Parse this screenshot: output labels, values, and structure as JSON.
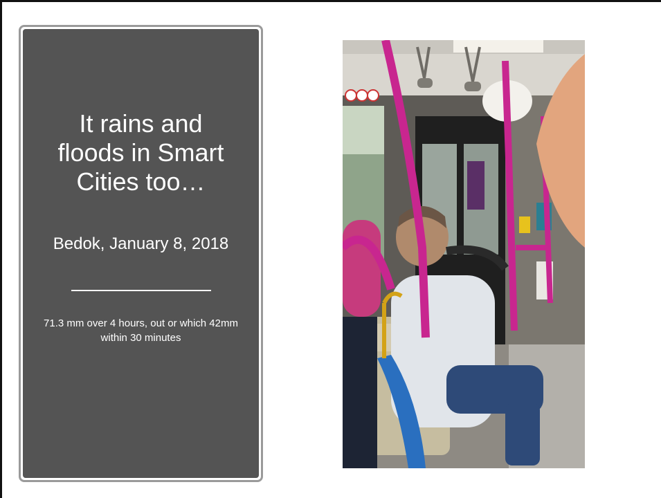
{
  "slide": {
    "title": "It rains and\nfloods in Smart\nCities too…",
    "subtitle": "Bedok, January 8, 2018",
    "caption": "71.3 mm over 4 hours, out or which 42mm within 30 minutes"
  },
  "photo": {
    "description_icon": "bus-interior-photo"
  },
  "colors": {
    "panel": "#545454",
    "panel_border": "#9a9a9a",
    "text": "#ffffff",
    "pole": "#c8268f"
  }
}
